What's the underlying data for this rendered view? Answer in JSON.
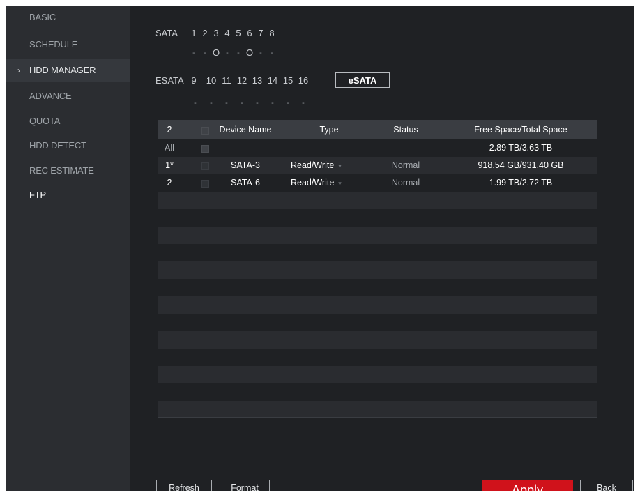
{
  "sidebar": {
    "items": [
      {
        "label": "BASIC"
      },
      {
        "label": "SCHEDULE"
      },
      {
        "label": "HDD MANAGER"
      },
      {
        "label": "ADVANCE"
      },
      {
        "label": "QUOTA"
      },
      {
        "label": "HDD DETECT"
      },
      {
        "label": "REC ESTIMATE"
      },
      {
        "label": "FTP"
      }
    ],
    "active_index": 2
  },
  "sata": {
    "label": "SATA",
    "ports": [
      "1",
      "2",
      "3",
      "4",
      "5",
      "6",
      "7",
      "8"
    ],
    "status": [
      "-",
      "-",
      "O",
      "-",
      "-",
      "O",
      "-",
      "-"
    ]
  },
  "esata": {
    "label": "ESATA",
    "ports": [
      "9",
      "10",
      "11",
      "12",
      "13",
      "14",
      "15",
      "16"
    ],
    "status": [
      "-",
      "-",
      "-",
      "-",
      "-",
      "-",
      "-",
      "-"
    ],
    "button_label": "eSATA"
  },
  "table": {
    "headers": [
      "2",
      "Device Name",
      "Type",
      "Status",
      "Free Space/Total Space"
    ],
    "rows": [
      {
        "no": "All",
        "device": "-",
        "type": "-",
        "status": "-",
        "space": "2.89 TB/3.63 TB"
      },
      {
        "no": "1*",
        "device": "SATA-3",
        "type": "Read/Write",
        "status": "Normal",
        "space": "918.54 GB/931.40 GB"
      },
      {
        "no": "2",
        "device": "SATA-6",
        "type": "Read/Write",
        "status": "Normal",
        "space": "1.99 TB/2.72 TB"
      }
    ],
    "dropdown_arrow": "▾"
  },
  "buttons": {
    "refresh": "Refresh",
    "format": "Format",
    "apply": "Apply",
    "back": "Back"
  },
  "colors": {
    "accent": "#d0121b",
    "background": "#1f2124",
    "sidebar": "#2b2d31"
  }
}
